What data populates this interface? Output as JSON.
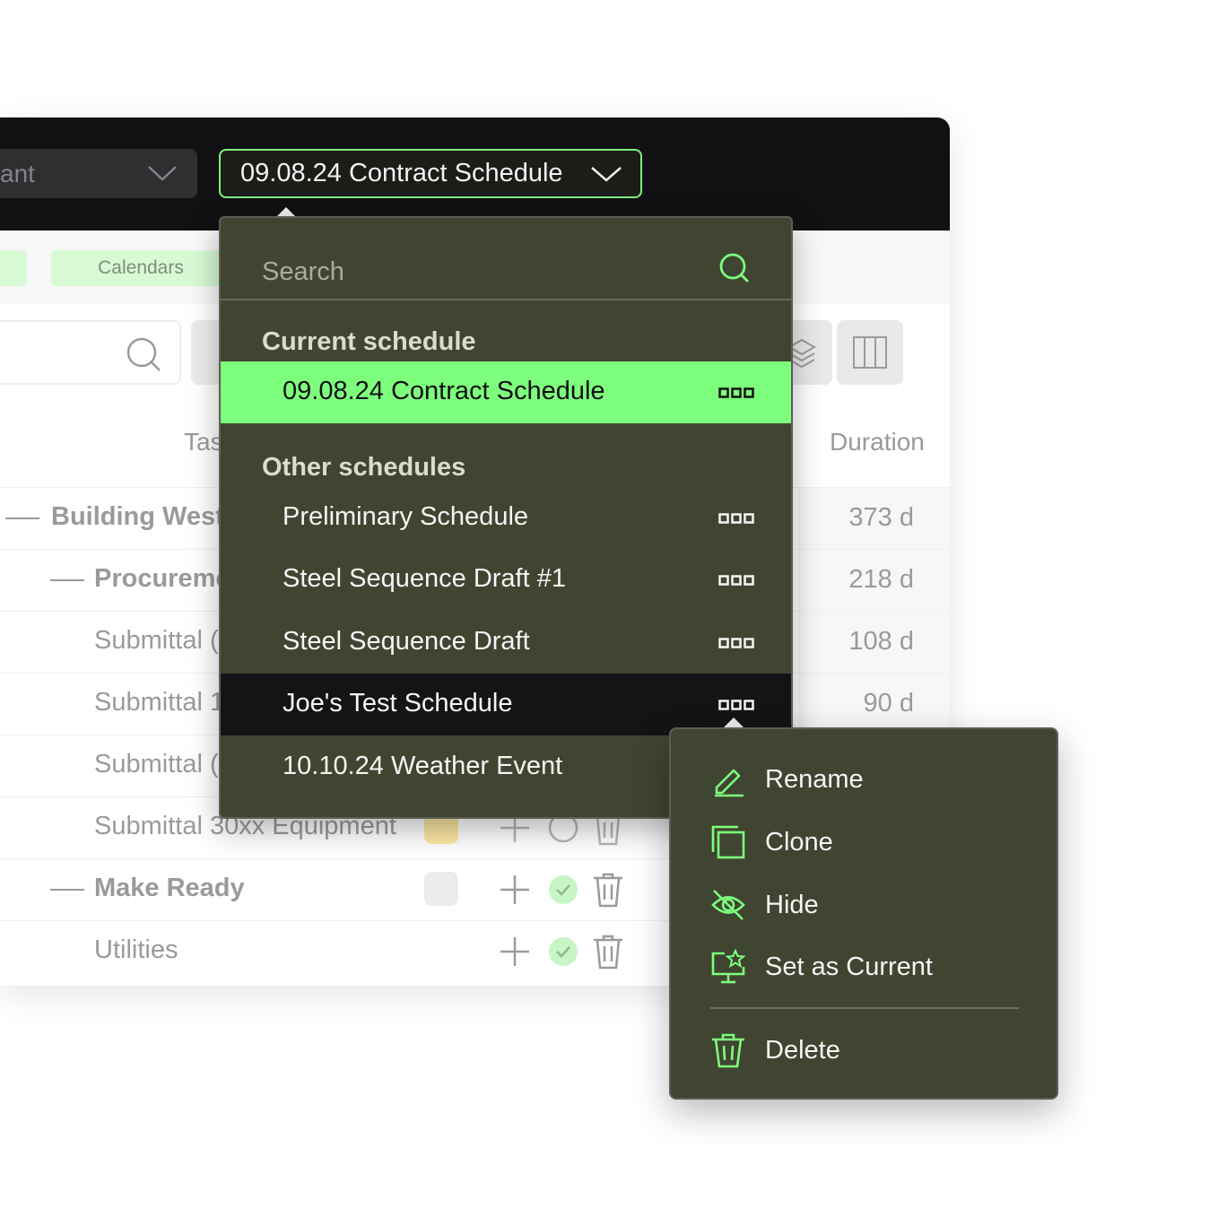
{
  "header": {
    "project_select_value": "ant",
    "schedule_select_value": "09.08.24 Contract Schedule"
  },
  "toolbar": {
    "tab_calendars": "Calendars"
  },
  "table": {
    "columns": {
      "task": "Tas",
      "duration": "Duration"
    },
    "rows": [
      {
        "name": "Building West",
        "duration": "373 d"
      },
      {
        "name": "Procureme",
        "duration": "218 d"
      },
      {
        "name": "Submittal (",
        "duration": "108 d"
      },
      {
        "name": "Submittal 1",
        "duration": "90 d"
      },
      {
        "name": "Submittal (",
        "duration": ""
      },
      {
        "name": "Submittal 30xx Equipment",
        "duration": ""
      },
      {
        "name": "Make Ready",
        "duration": ""
      },
      {
        "name": "Utilities",
        "duration": ""
      }
    ]
  },
  "dropdown": {
    "search_placeholder": "Search",
    "current_group_label": "Current schedule",
    "current_item": "09.08.24 Contract Schedule",
    "other_group_label": "Other schedules",
    "other_items": [
      "Preliminary Schedule",
      "Steel Sequence Draft #1",
      "Steel Sequence Draft",
      "Joe's Test Schedule",
      "10.10.24 Weather Event"
    ]
  },
  "context_menu": {
    "rename": "Rename",
    "clone": "Clone",
    "hide": "Hide",
    "set_current": "Set as Current",
    "delete": "Delete"
  },
  "colors": {
    "accent": "#7dff7d",
    "menu_bg": "#3f4530",
    "topbar_bg": "#111013"
  }
}
